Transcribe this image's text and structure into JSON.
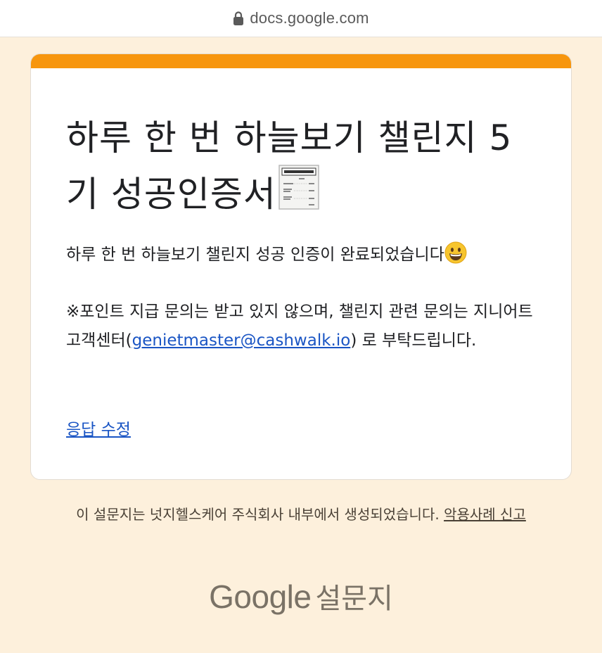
{
  "browser": {
    "url": "docs.google.com",
    "lock_icon": "lock-icon"
  },
  "colors": {
    "accent": "#f7960e",
    "background": "#fdf0dc",
    "link": "#1a55c4"
  },
  "form": {
    "title": "하루 한 번 하늘보기 챌린지 5기 성공인증서",
    "title_icon": "receipt-icon",
    "confirmation_message": "하루 한 번 하늘보기 챌린지 성공 인증이 완료되었습니다",
    "message_icon": "grinning-face-icon",
    "notice": {
      "before": "※포인트 지급 문의는 받고 있지 않으며, 챌린지 관련 문의는 지니어트 고객센터(",
      "email": "genietmaster@cashwalk.io",
      "after": ") 로 부탁드립니다."
    },
    "edit_response_label": "응답 수정"
  },
  "footer": {
    "created_by": "이 설문지는 넛지헬스케어 주식회사 내부에서 생성되었습니다.",
    "report_abuse_label": "악용사례 신고",
    "brand_google": "Google",
    "brand_forms": "설문지"
  }
}
